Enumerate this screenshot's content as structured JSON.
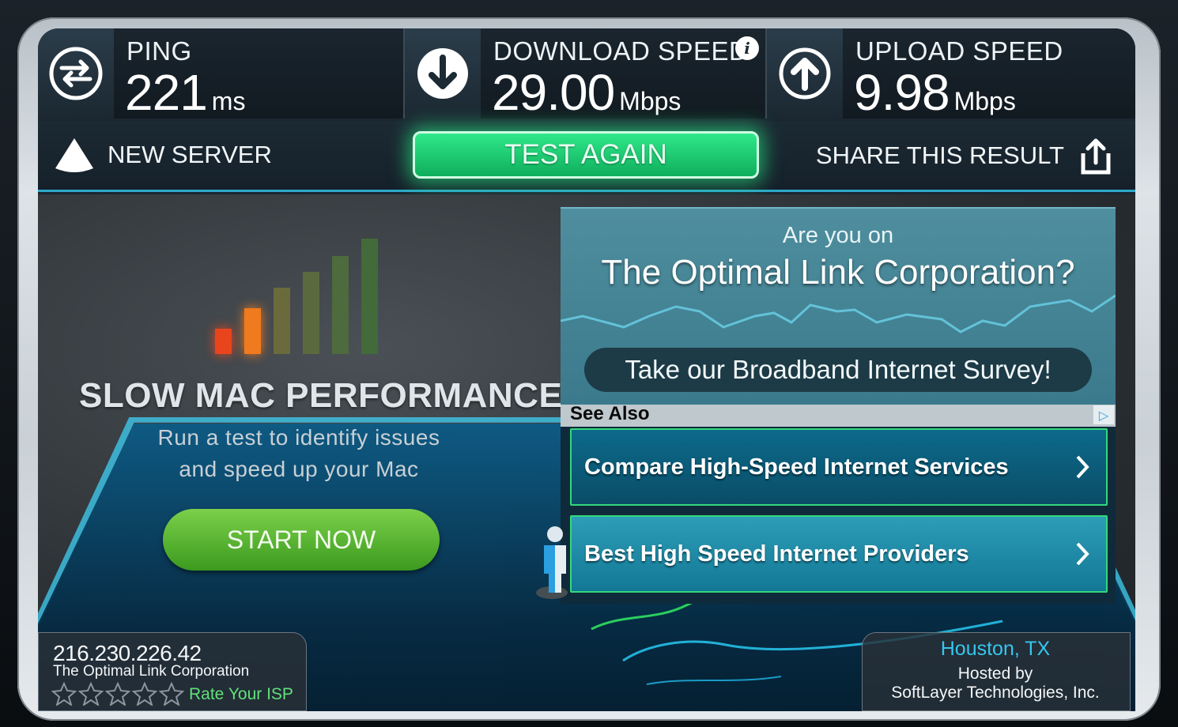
{
  "stats": {
    "ping": {
      "label": "PING",
      "value": "221",
      "unit": "ms",
      "icon": "exchange-arrows-icon"
    },
    "download": {
      "label": "DOWNLOAD SPEED",
      "value": "29.00",
      "unit": "Mbps",
      "icon": "download-arrow-icon",
      "info_icon": "i"
    },
    "upload": {
      "label": "UPLOAD SPEED",
      "value": "9.98",
      "unit": "Mbps",
      "icon": "upload-arrow-icon"
    }
  },
  "actions": {
    "new_server": "NEW SERVER",
    "test_again": "TEST AGAIN",
    "share": "SHARE THIS RESULT"
  },
  "ad_left": {
    "title": "SLOW MAC PERFORMANCE?",
    "line1": "Run a test to identify issues",
    "line2": "and speed up your Mac",
    "button": "START NOW",
    "bar_colors": [
      "#e8451d",
      "#f07a1e",
      "#6b6a3c",
      "#5b6a3e",
      "#4d6b3c",
      "#436a3a"
    ]
  },
  "ad_right": {
    "question_small": "Are you on",
    "question_big": "The Optimal Link Corporation?",
    "survey_button": "Take our Broadband Internet Survey!"
  },
  "see_also": {
    "heading": "See Also",
    "links": [
      {
        "label": "Compare High-Speed Internet Services"
      },
      {
        "label": "Best High Speed Internet Providers"
      }
    ]
  },
  "client": {
    "ip": "216.230.226.42",
    "isp": "The Optimal Link Corporation",
    "rate": "Rate Your ISP",
    "stars": 0
  },
  "server": {
    "city": "Houston, TX",
    "hosted_by": "Hosted by",
    "host": "SoftLayer Technologies, Inc."
  },
  "colors": {
    "accent": "#2ea7c9",
    "test_again_green": "#1fd171",
    "start_green": "#5bb833",
    "city_blue": "#37c6ee",
    "rate_green": "#62e07a"
  }
}
